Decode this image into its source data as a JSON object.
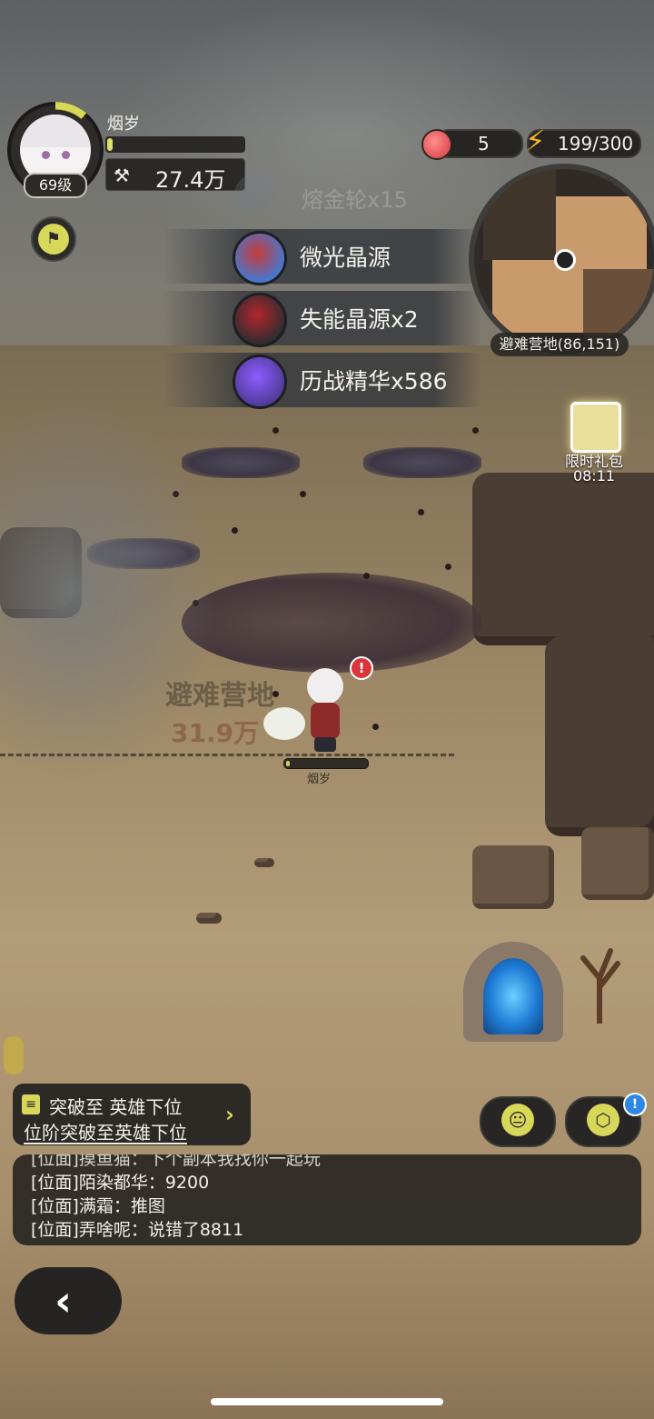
{
  "player": {
    "name": "烟岁",
    "level_label": "69级",
    "power_value": "27.4万",
    "power_icon": "⚒",
    "exp_progress": 0.04
  },
  "resources": {
    "stamina_apples": "5",
    "energy": "199/300",
    "apple_icon": "apple-icon",
    "energy_icon": "lightning-icon"
  },
  "loot": {
    "faded": "熔金轮x15",
    "items": [
      {
        "label": "微光晶源",
        "color": "#c73b3b",
        "ring": "#3e7ad6"
      },
      {
        "label": "失能晶源x2",
        "color": "#b3262d",
        "ring": "#2c2c30"
      },
      {
        "label": "历战精华x586",
        "color": "#8d5bff",
        "ring": "#4d3b94"
      }
    ]
  },
  "minimap": {
    "location": "避难营地(86,151)"
  },
  "gift": {
    "label": "限时礼包",
    "timer": "08:11"
  },
  "world": {
    "zone_name": "避难营地",
    "zone_power": "31.9万",
    "hero_name": "烟岁",
    "hero_hp": 0.05,
    "alert": "!"
  },
  "quest": {
    "title": "突破至 英雄下位",
    "subtitle": "位阶突破至英雄下位",
    "arrow": "›"
  },
  "buttons": {
    "emote_icon": "face-icon",
    "box_icon": "cube-icon",
    "box_badge": "!",
    "back_label": "‹"
  },
  "chat": {
    "lines": [
      "[位面]摸鱼猫：下个副本我找你一起玩",
      "[位面]陌染都华：9200",
      "[位面]满霜：推图",
      "[位面]弄啥呢：说错了8811"
    ]
  },
  "colors": {
    "accent_yellow": "#d7d75a",
    "hud_dark": "#262523",
    "energy_bolt": "#f3b62b"
  }
}
